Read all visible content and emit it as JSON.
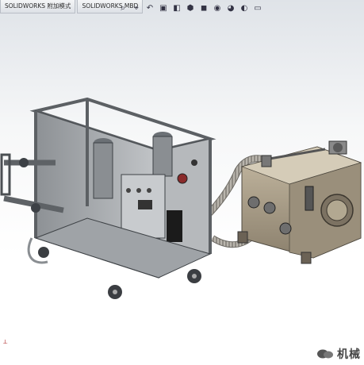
{
  "tabs": [
    {
      "label": "SOLIDWORKS 附加模式"
    },
    {
      "label": "SOLIDWORKS MBD"
    }
  ],
  "heads_up_toolbar": [
    {
      "icon": "zoom-fit-icon",
      "glyph": "⌕"
    },
    {
      "icon": "zoom-area-icon",
      "glyph": "⌖"
    },
    {
      "icon": "previous-view-icon",
      "glyph": "↶"
    },
    {
      "icon": "section-view-icon",
      "glyph": "▣"
    },
    {
      "icon": "dynamic-annotation-icon",
      "glyph": "◧"
    },
    {
      "icon": "view-orientation-icon",
      "glyph": "⬢"
    },
    {
      "icon": "display-style-icon",
      "glyph": "◼"
    },
    {
      "icon": "hide-show-items-icon",
      "glyph": "◉"
    },
    {
      "icon": "edit-appearance-icon",
      "glyph": "◕"
    },
    {
      "icon": "apply-scene-icon",
      "glyph": "◐"
    },
    {
      "icon": "view-settings-icon",
      "glyph": "▭"
    }
  ],
  "watermark": {
    "text": "机械"
  },
  "colors": {
    "frame": "#9ea2a6",
    "frame_dark": "#6f7378",
    "panel": "#c9ccd0",
    "tank": "#a89b84",
    "hose": "#b7b3aa"
  }
}
